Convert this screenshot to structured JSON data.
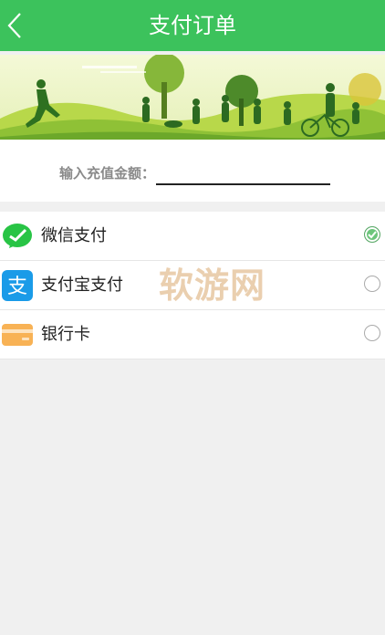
{
  "header": {
    "title": "支付订单"
  },
  "banner": {
    "icon": "silhouette-park-illustration"
  },
  "amount": {
    "label": "输入充值金额：",
    "value": ""
  },
  "payment_methods": [
    {
      "label": "微信支付",
      "icon": "wechat-icon",
      "selected": true
    },
    {
      "label": "支付宝支付",
      "icon": "alipay-icon",
      "selected": false
    },
    {
      "label": "银行卡",
      "icon": "bank-card-icon",
      "selected": false
    }
  ],
  "watermark": "软游网",
  "colors": {
    "header_bg": "#3cc25c",
    "wechat_green": "#28c445",
    "alipay_blue": "#1a9be8",
    "card_orange": "#f8b255",
    "checked_green": "#6cc57b"
  }
}
